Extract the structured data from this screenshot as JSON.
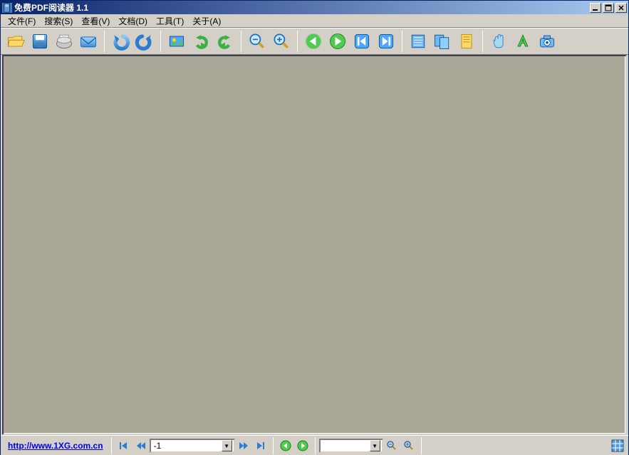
{
  "title": "免费PDF阅读器 1.1",
  "menu": {
    "file": "文件(F)",
    "search": "搜索(S)",
    "view": "查看(V)",
    "doc": "文档(D)",
    "tools": "工具(T)",
    "about": "关于(A)"
  },
  "toolbar": {
    "open": "open",
    "save": "save",
    "print": "print",
    "mail": "mail",
    "undo": "undo",
    "redo": "redo",
    "snapshot": "snapshot",
    "rotccw": "rotate-ccw",
    "rotcw": "rotate-cw",
    "zoomout": "zoom-out",
    "zoomin": "zoom-in",
    "back": "back",
    "forward": "forward",
    "first": "first",
    "last": "last",
    "single": "single",
    "continuous": "continuous",
    "fitpage": "fit-page",
    "hand": "hand",
    "text": "text-select",
    "camera": "camera"
  },
  "nav": {
    "link_text": "http://www.1XG.com.cn",
    "link_href": "http://www.1XG.com.cn",
    "page_value": "-1",
    "zoom_value": "",
    "search_value": ""
  },
  "icons": {
    "min": "0",
    "max": "1",
    "close": "r"
  }
}
